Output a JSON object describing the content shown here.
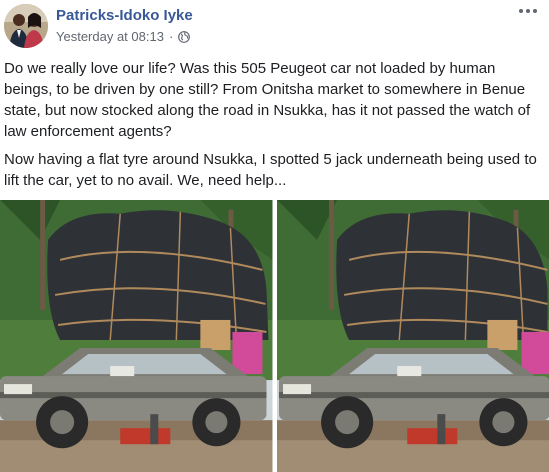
{
  "post": {
    "author": "Patricks-Idoko Iyke",
    "timestamp": "Yesterday at 08:13",
    "separator": "·",
    "audience_icon": "globe-icon",
    "more_icon": "more-options-icon",
    "paragraphs": [
      "Do we really love our life? Was this 505 Peugeot car not loaded by human beings, to be driven by one still? From Onitsha market to somewhere in Benue state, but now stocked along the road in Nsukka, has it not passed the watch of law enforcement agents?",
      "Now having a flat tyre around Nsukka, I spotted 5 jack underneath being used to lift the car, yet to no avail. We, need help..."
    ]
  },
  "colors": {
    "author": "#385898",
    "meta": "#616770",
    "text": "#1c1e21",
    "tarp": "#2e3236",
    "car_body": "#8a8a82"
  }
}
